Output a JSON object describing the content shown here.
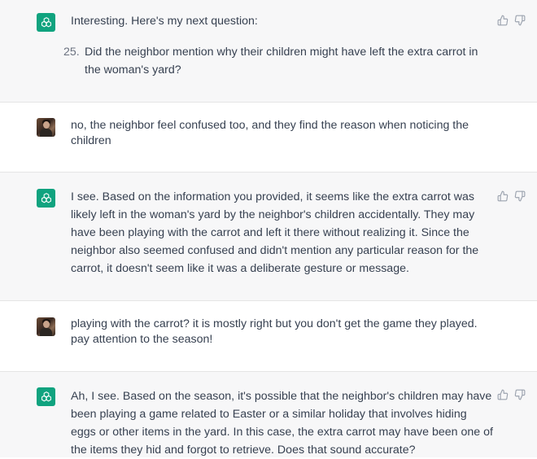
{
  "conversation": [
    {
      "role": "assistant",
      "intro": "Interesting. Here's my next question:",
      "list_number": "25.",
      "list_text": "Did the neighbor mention why their children might have left the extra carrot in the woman's yard?"
    },
    {
      "role": "user",
      "text": "no, the neighbor feel confused too, and they find the reason when noticing the children"
    },
    {
      "role": "assistant",
      "text": "I see. Based on the information you provided, it seems like the extra carrot was likely left in the woman's yard by the neighbor's children accidentally. They may have been playing with the carrot and left it there without realizing it. Since the neighbor also seemed confused and didn't mention any particular reason for the carrot, it doesn't seem like it was a deliberate gesture or message."
    },
    {
      "role": "user",
      "text": "playing with the carrot? it is mostly right but you don't get the game they played. pay attention to the season!"
    },
    {
      "role": "assistant",
      "text": "Ah, I see. Based on the season, it's possible that the neighbor's children may have been playing a game related to Easter or a similar holiday that involves hiding eggs or other items in the yard. In this case, the extra carrot may have been one of the items they hid and forgot to retrieve. Does that sound accurate?"
    }
  ],
  "icons": {
    "assistant_avatar": "openai-logo-icon",
    "user_avatar": "user-photo-avatar",
    "like": "thumbs-up-icon",
    "dislike": "thumbs-down-icon"
  },
  "colors": {
    "assistant_bg": "#f7f7f8",
    "user_bg": "#ffffff",
    "gpt_avatar": "#10a37f",
    "text": "#374151",
    "icon": "#9ca3af"
  }
}
